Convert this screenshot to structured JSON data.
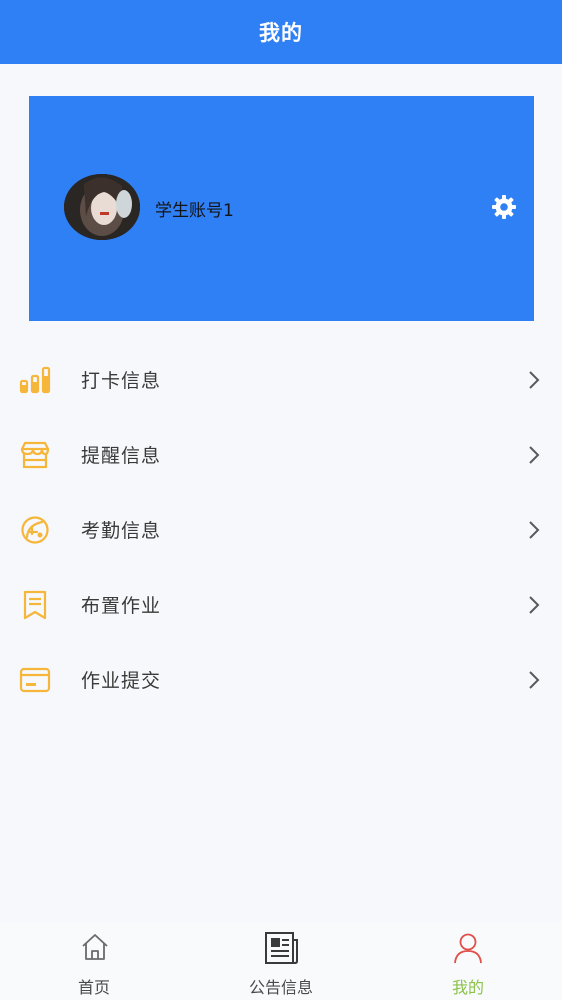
{
  "header": {
    "title": "我的"
  },
  "profile": {
    "username": "学生账号1"
  },
  "menu": [
    {
      "label": "打卡信息",
      "icon": "bar-chart-icon"
    },
    {
      "label": "提醒信息",
      "icon": "store-icon"
    },
    {
      "label": "考勤信息",
      "icon": "leaf-badge-icon"
    },
    {
      "label": "布置作业",
      "icon": "bookmark-doc-icon"
    },
    {
      "label": "作业提交",
      "icon": "card-icon"
    }
  ],
  "nav": {
    "home": "首页",
    "notice": "公告信息",
    "mine": "我的"
  },
  "colors": {
    "primary": "#2f7ff5",
    "icon_accent": "#f5b63a",
    "nav_active": "#8bc34a",
    "nav_active_icon": "#e0504a"
  }
}
